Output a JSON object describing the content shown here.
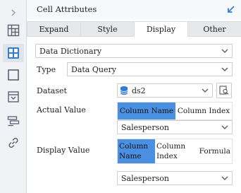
{
  "panel": {
    "title": "Cell Attributes"
  },
  "tabs": [
    {
      "label": "Expand",
      "active": false
    },
    {
      "label": "Style",
      "active": false
    },
    {
      "label": "Display",
      "active": true
    },
    {
      "label": "Other",
      "active": false
    }
  ],
  "display": {
    "dictionary_select": "Data Dictionary",
    "type_label": "Type",
    "type_value": "Data Query",
    "dataset_label": "Dataset",
    "dataset_value": "ds2",
    "actual_value_label": "Actual Value",
    "actual_value_options": [
      "Column Name",
      "Column Index"
    ],
    "actual_value_selected": "Column Name",
    "actual_value_field": "Salesperson",
    "display_value_label": "Display Value",
    "display_value_options": [
      "Column Name",
      "Column Index",
      "Formula"
    ],
    "display_value_selected": "Column Name",
    "display_value_field": "Salesperson"
  },
  "colors": {
    "accent": "#4a90e2",
    "sidebar_active_icon": "#2f7fd8",
    "sidebar_icon": "#5a6270"
  },
  "icons": {
    "sidebar": [
      "expand-arrow-icon",
      "cell-grid-icon",
      "widget-icon",
      "border-icon",
      "dropdown-box-icon",
      "condition-list-icon",
      "link-icon"
    ],
    "collapse": "collapse-arrow-icon",
    "dataset": "database-icon",
    "preview": "preview-search-icon"
  }
}
